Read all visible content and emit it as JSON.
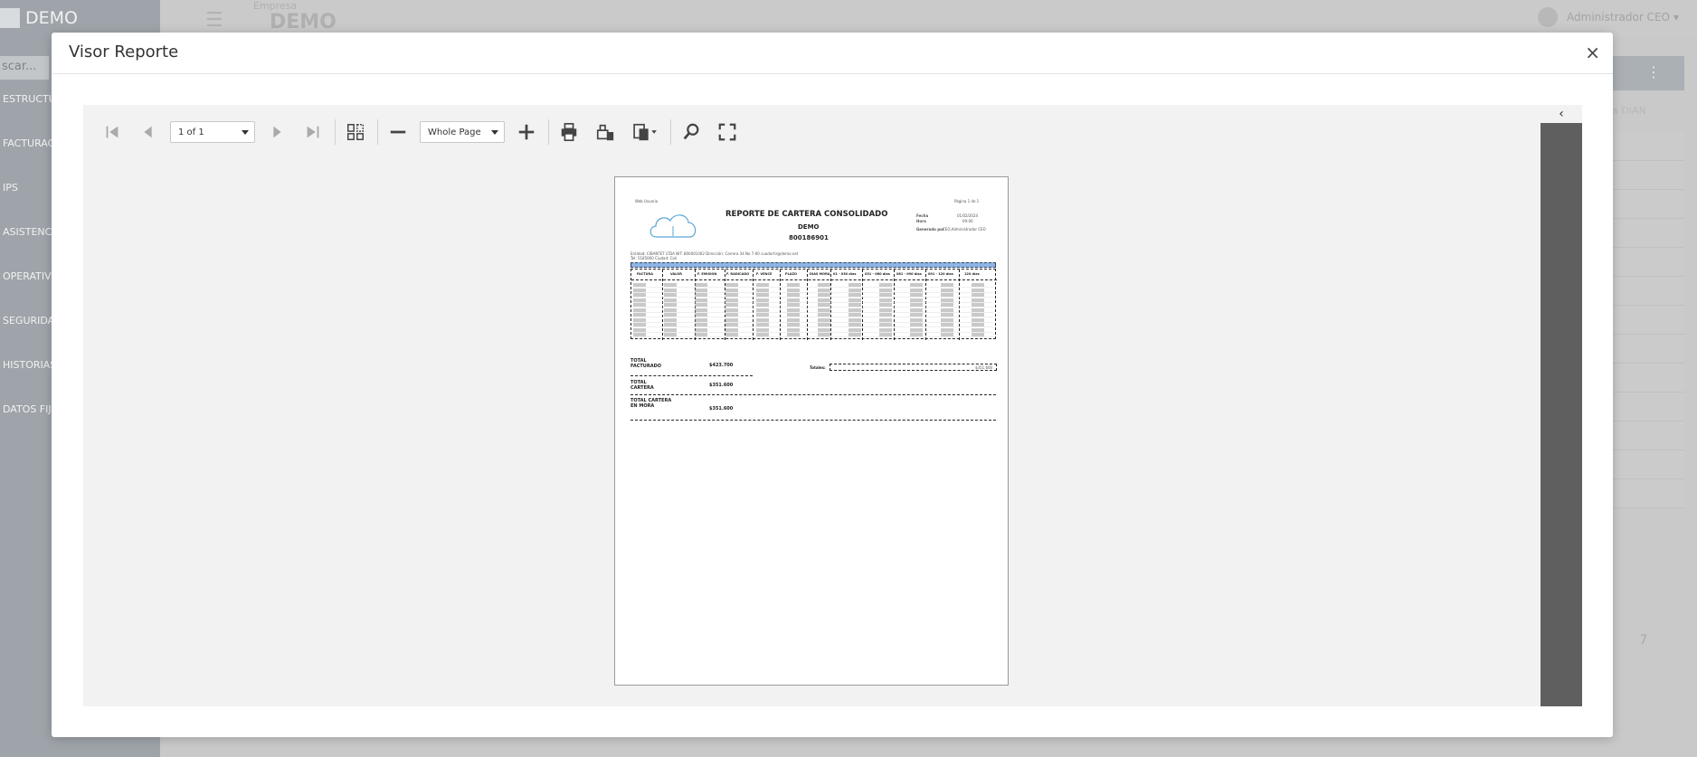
{
  "background": {
    "brand": "DEMO",
    "search_placeholder": "scar...",
    "nav_items": [
      "ESTRUCTU",
      "FACTURAC",
      "IPS",
      "ASISTENCI",
      "OPERATIV",
      "SEGURIDA",
      "HISTORIAS",
      "DATOS FIJ"
    ],
    "empresa_label": "Empresa",
    "empresa_value": "DEMO",
    "user_name": "Administrador CEO",
    "column_header": "a DIAN",
    "pager_values": [
      "5",
      "7"
    ]
  },
  "modal": {
    "title": "Visor Reporte",
    "close_label": "×"
  },
  "toolbar": {
    "page_select": "1 of 1",
    "zoom_select": "Whole Page"
  },
  "report": {
    "header_left": "Web Usuario",
    "page_label": "Página 1 de 1",
    "title": "REPORTE DE CARTERA CONSOLIDADO",
    "company": "DEMO",
    "nit": "800186901",
    "fecha_label": "Fecha",
    "fecha_value": "01/02/2024",
    "hora_label": "Hora",
    "hora_value": "09:00",
    "generado_label": "Generado por",
    "generado_value": "CEO,Administrador CEO",
    "entidad_line": "Entidad: CIBANTET LTDA                NIT: 800001002        Dirección: Carrera 34 No 7-00   cuadortir@demo.net",
    "tel_line": "Tel: 5185000                Ciudad: Cali",
    "columns": [
      "FACTURA",
      "VALOR",
      "F. EMISION",
      "F. RADICADO",
      "F. VENCE",
      "PLAZO",
      "DIAS MORA",
      "01 - 030 días",
      "031 - 060 días",
      "061 - 090 días",
      "091 - 120 días",
      "120 días"
    ],
    "total_facturado_label": "TOTAL FACTURADO",
    "total_facturado_value": "$423.700",
    "total_cartera_label": "TOTAL CARTERA",
    "total_cartera_value": "$351.600",
    "total_mora_label": "TOTAL CARTERA EN MORA",
    "total_mora_value": "$351.600",
    "totales_label": "Totales:",
    "totales_last": "$351.600"
  },
  "colors": {
    "sidebar": "#9ea4a9",
    "overlay": "#c9c9c9",
    "viewer_bg": "#f2f2f2",
    "sidepanel": "#5f5f5f",
    "band_blue": "#8fb4e6"
  }
}
